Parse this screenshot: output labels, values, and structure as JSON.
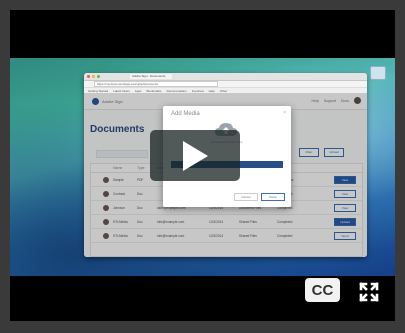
{
  "browser": {
    "tab_label": "Adobe Sign - Documents",
    "url": "https://my.documentsapp.example/documents",
    "bookmarks": [
      "Getting Started",
      "Latest News",
      "Apps",
      "Bookmarks",
      "Documentation",
      "Imported",
      "Help",
      "Other"
    ]
  },
  "app": {
    "brand": "Adobe Sign",
    "header_links": [
      "Help",
      "Support",
      "Docs"
    ],
    "page_title": "Documents",
    "toolbar_buttons": [
      "Filter",
      "Upload"
    ],
    "table": {
      "headers": [
        "",
        "Name",
        "Type",
        "Email",
        "Date",
        "Owner",
        "Status",
        ""
      ],
      "rows": [
        {
          "name": "Sample",
          "type": "PDF",
          "email": "",
          "date": "",
          "owner": "",
          "status": "In Progress",
          "action": "View",
          "action_filled": true
        },
        {
          "name": "Contract",
          "type": "Doc",
          "email": "",
          "date": "",
          "owner": "",
          "status": "Completed",
          "action": "View",
          "action_filled": false
        },
        {
          "name": "Johnson",
          "type": "Doc",
          "email": "user@example.com",
          "date": "12/3/2014",
          "owner": "Document Files",
          "status": "Completed",
          "action": "View",
          "action_filled": false
        },
        {
          "name": "HTLMedia",
          "type": "Doc",
          "email": "info@example.com",
          "date": "12/3/2014",
          "owner": "Shared Files",
          "status": "Completed",
          "action": "Upload",
          "action_filled": true
        },
        {
          "name": "HTLMedia",
          "type": "Doc",
          "email": "info@example.com",
          "date": "12/3/2014",
          "owner": "Shared Files",
          "status": "Completed",
          "action": "Send",
          "action_filled": false
        }
      ]
    }
  },
  "modal": {
    "title": "Add Media",
    "close": "×",
    "subtitle": "Drag and drop files here",
    "buttons": [
      "Cancel",
      "Done"
    ]
  },
  "video_controls": {
    "cc_label": "CC",
    "play_icon": "play-icon",
    "fullscreen_icon": "fullscreen-icon"
  },
  "colors": {
    "brand_blue": "#2a4f86",
    "accent_blue": "#3b6fb6",
    "play_bg": "#172322"
  }
}
